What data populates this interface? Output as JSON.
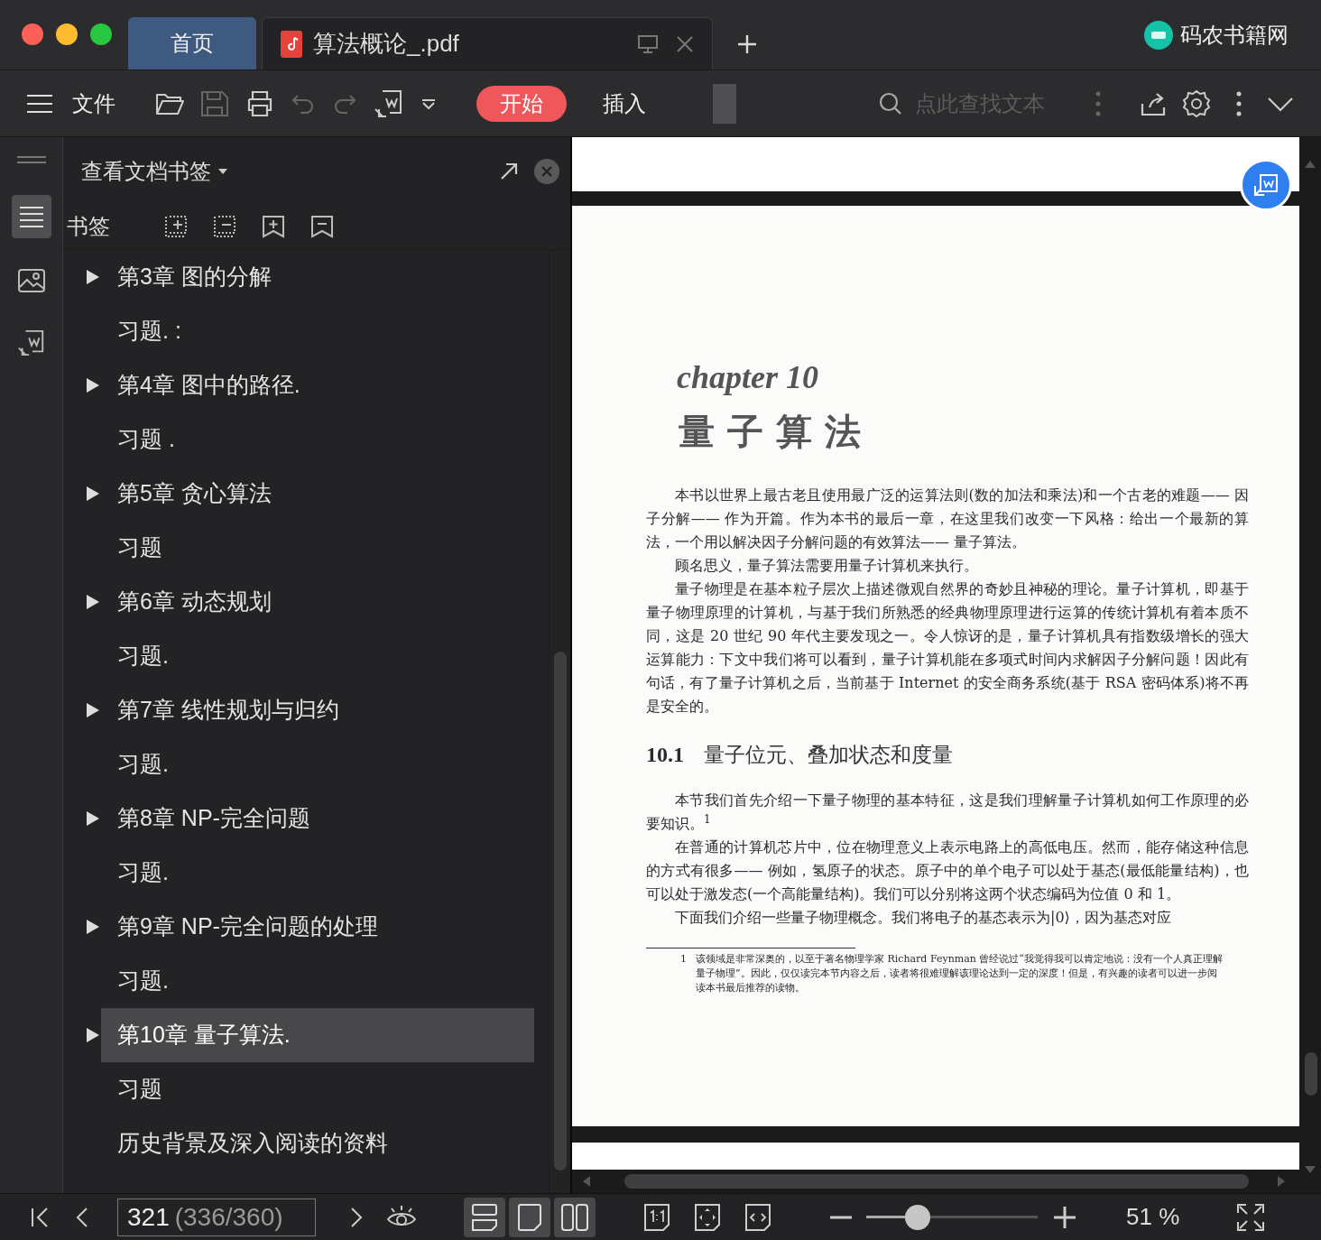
{
  "tabs": [
    {
      "label": "首页",
      "kind": "home",
      "selected": false
    },
    {
      "label": "算法概论_.pdf",
      "kind": "file",
      "selected": true
    }
  ],
  "brand": {
    "name": "码农书籍网"
  },
  "toolbar": {
    "file_menu": "文件",
    "ribbon_tabs": [
      {
        "label": "开始",
        "selected": true
      },
      {
        "label": "插入",
        "selected": false
      }
    ],
    "search": {
      "placeholder": "点此查找文本"
    }
  },
  "sidebar": {
    "title": "查看文档书签",
    "section": "书签",
    "bookmarks": [
      {
        "label": "第3章 图的分解",
        "kind": "chapter",
        "selected": false
      },
      {
        "label": "习题. :",
        "kind": "entry",
        "selected": false
      },
      {
        "label": "第4章 图中的路径.",
        "kind": "chapter",
        "selected": false
      },
      {
        "label": "习题 .",
        "kind": "entry",
        "selected": false
      },
      {
        "label": "第5章 贪心算法",
        "kind": "chapter",
        "selected": false
      },
      {
        "label": "习题",
        "kind": "entry",
        "selected": false
      },
      {
        "label": "第6章 动态规划",
        "kind": "chapter",
        "selected": false
      },
      {
        "label": "习题.",
        "kind": "entry",
        "selected": false
      },
      {
        "label": "第7章 线性规划与归约",
        "kind": "chapter",
        "selected": false
      },
      {
        "label": "习题.",
        "kind": "entry",
        "selected": false
      },
      {
        "label": "第8章 NP-完全问题",
        "kind": "chapter",
        "selected": false
      },
      {
        "label": "习题.",
        "kind": "entry",
        "selected": false
      },
      {
        "label": "第9章 NP-完全问题的处理",
        "kind": "chapter",
        "selected": false
      },
      {
        "label": "习题.",
        "kind": "entry",
        "selected": false
      },
      {
        "label": "第10章 量子算法.",
        "kind": "chapter",
        "selected": true
      },
      {
        "label": "习题",
        "kind": "entry",
        "selected": false
      },
      {
        "label": "历史背景及深入阅读的资料",
        "kind": "entry",
        "selected": false
      }
    ]
  },
  "document": {
    "chapter_label": "chapter 10",
    "chapter_title": "量 子 算 法",
    "intro_paragraphs": [
      "本书以世界上最古老且使用最广泛的运算法则(数的加法和乘法)和一个古老的难题—— 因子分解—— 作为开篇。作为本书的最后一章，在这里我们改变一下风格：给出一个最新的算法，一个用以解决因子分解问题的有效算法—— 量子算法。",
      "顾名思义，量子算法需要用量子计算机来执行。",
      "量子物理是在基本粒子层次上描述微观自然界的奇妙且神秘的理论。量子计算机，即基于量子物理原理的计算机，与基于我们所熟悉的经典物理原理进行运算的传统计算机有着本质不同，这是 20 世纪 90 年代主要发现之一。令人惊讶的是，量子计算机具有指数级增长的强大运算能力：下文中我们将可以看到，量子计算机能在多项式时间内求解因子分解问题！因此有句话，有了量子计算机之后，当前基于 Internet 的安全商务系统(基于 RSA 密码体系)将不再是安全的。"
    ],
    "section_number": "10.1",
    "section_title": "量子位元、叠加状态和度量",
    "section_paragraphs": [
      "本节我们首先介绍一下量子物理的基本特征，这是我们理解量子计算机如何工作原理的必要知识。$^{1}$",
      "在普通的计算机芯片中，位在物理意义上表示电路上的高低电压。然而，能存储这种信息的方式有很多—— 例如，氢原子的状态。原子中的单个电子可以处于基态(最低能量结构)，也可以处于激发态(一个高能量结构)。我们可以分别将这两个状态编码为位值 0 和 1。",
      "下面我们介绍一些量子物理概念。我们将电子的基态表示为|0⟩，因为基态对应"
    ],
    "footnote": {
      "number": "1",
      "text": "该领域是非常深奥的，以至于著名物理学家 Richard Feynman 曾经说过“我觉得我可以肯定地说：没有一个人真正理解量子物理”。因此，仅仅读完本节内容之后，读者将很难理解该理论达到一定的深度！但是，有兴趣的读者可以进一步阅读本书最后推荐的读物。"
    }
  },
  "status_bar": {
    "page_input": "321",
    "page_count": "(336/360)",
    "zoom": {
      "level": 0.3,
      "reading": "51 %"
    }
  }
}
